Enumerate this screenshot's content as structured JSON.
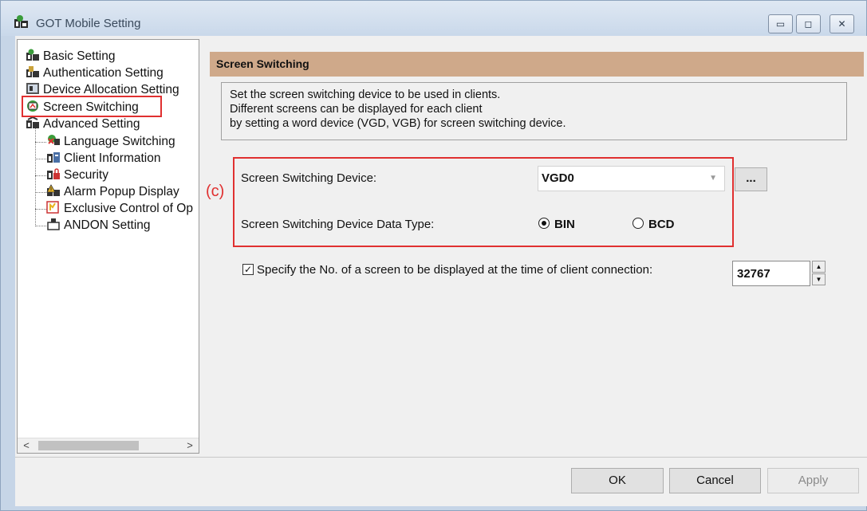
{
  "window": {
    "title": "GOT Mobile Setting",
    "controls": {
      "minimize": "▭",
      "maximize": "◻",
      "close": "✕"
    }
  },
  "tree": {
    "items": [
      {
        "label": "Basic Setting",
        "icon": "basic-setting-icon"
      },
      {
        "label": "Authentication Setting",
        "icon": "authentication-icon"
      },
      {
        "label": "Device Allocation Setting",
        "icon": "device-allocation-icon"
      },
      {
        "label": "Screen Switching",
        "icon": "screen-switching-icon",
        "selected": true
      },
      {
        "label": "Advanced Setting",
        "icon": "advanced-setting-icon"
      },
      {
        "label": "Language Switching",
        "icon": "language-switching-icon"
      },
      {
        "label": "Client Information",
        "icon": "client-information-icon"
      },
      {
        "label": "Security",
        "icon": "security-icon"
      },
      {
        "label": "Alarm Popup Display",
        "icon": "alarm-popup-icon"
      },
      {
        "label": "Exclusive Control of Op",
        "icon": "exclusive-control-icon"
      },
      {
        "label": "ANDON Setting",
        "icon": "andon-setting-icon"
      }
    ],
    "scroll_left": "<",
    "scroll_right": ">"
  },
  "panel": {
    "header": "Screen Switching",
    "description": [
      "Set the screen switching device to be used in clients.",
      "Different screens can be displayed for each client",
      "by setting a word device (VGD, VGB) for screen switching device."
    ],
    "annotation": "(c)",
    "device_label": "Screen Switching Device:",
    "device_value": "VGD0",
    "browse_button": "...",
    "data_type_label": "Screen Switching Device Data Type:",
    "data_type_options": [
      {
        "label": "BIN",
        "selected": true
      },
      {
        "label": "BCD",
        "selected": false
      }
    ],
    "specify_checkbox_label": "Specify the No. of a screen to be displayed at the time of client connection:",
    "specify_checked": true,
    "screen_number": "32767"
  },
  "footer": {
    "ok": "OK",
    "cancel": "Cancel",
    "apply": "Apply"
  },
  "colors": {
    "highlight_red": "#e03030",
    "header_tan": "#cfa98a",
    "frame_blue": "#c6d5e7"
  }
}
